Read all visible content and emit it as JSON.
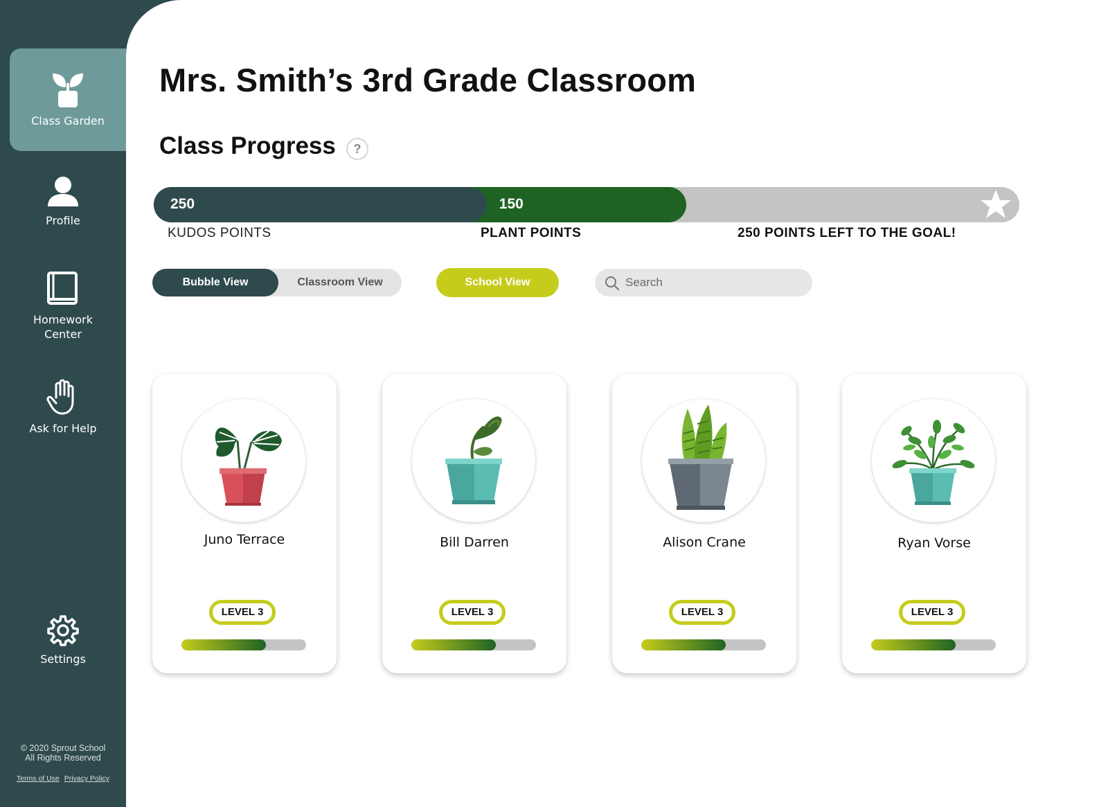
{
  "sidebar": {
    "items": [
      {
        "label": "Class Garden",
        "icon": "sprout-icon",
        "active": true
      },
      {
        "label": "Profile",
        "icon": "user-icon"
      },
      {
        "label": "Homework\nCenter",
        "icon": "book-icon"
      },
      {
        "label": "Ask for Help",
        "icon": "raised-hand-icon"
      },
      {
        "label": "Settings",
        "icon": "gear-icon"
      }
    ],
    "footer": {
      "copyright": "© 2020 Sprout School",
      "rights": "All Rights Reserved",
      "terms": "Terms of Use",
      "privacy": "Privacy Policy"
    }
  },
  "header": {
    "title": "Mrs. Smith’s 3rd Grade Classroom",
    "section_title": "Class Progress",
    "help_label": "?"
  },
  "progress": {
    "kudos_value": "250",
    "plant_value": "150",
    "kudos_label": "KUDOS POINTS",
    "plant_label": "PLANT POINTS",
    "goal_label": "250 POINTS LEFT TO THE GOAL!",
    "kudos_points": 250,
    "plant_points": 150,
    "remaining_points": 250,
    "goal_icon": "star-icon",
    "colors": {
      "kudos": "#2f4a4c",
      "plant": "#1e6323",
      "remaining": "#c4c4c4"
    }
  },
  "controls": {
    "bubble_view": "Bubble View",
    "classroom_view": "Classroom View",
    "school_view": "School View",
    "search_placeholder": "Search"
  },
  "students": [
    {
      "name": "Juno Terrace",
      "level": "LEVEL 3",
      "progress": 0.68,
      "plant": "monstera-red-pot"
    },
    {
      "name": "Bill Darren",
      "level": "LEVEL 3",
      "progress": 0.68,
      "plant": "sprout-teal-pot"
    },
    {
      "name": "Alison Crane",
      "level": "LEVEL 3",
      "progress": 0.68,
      "plant": "snake-plant-gray-pot"
    },
    {
      "name": "Ryan Vorse",
      "level": "LEVEL 3",
      "progress": 0.68,
      "plant": "leafy-teal-pot"
    }
  ],
  "colors": {
    "accent": "#c6cc1c",
    "sidebar": "#2f4a4c",
    "active_nav": "#6f9a9a"
  }
}
